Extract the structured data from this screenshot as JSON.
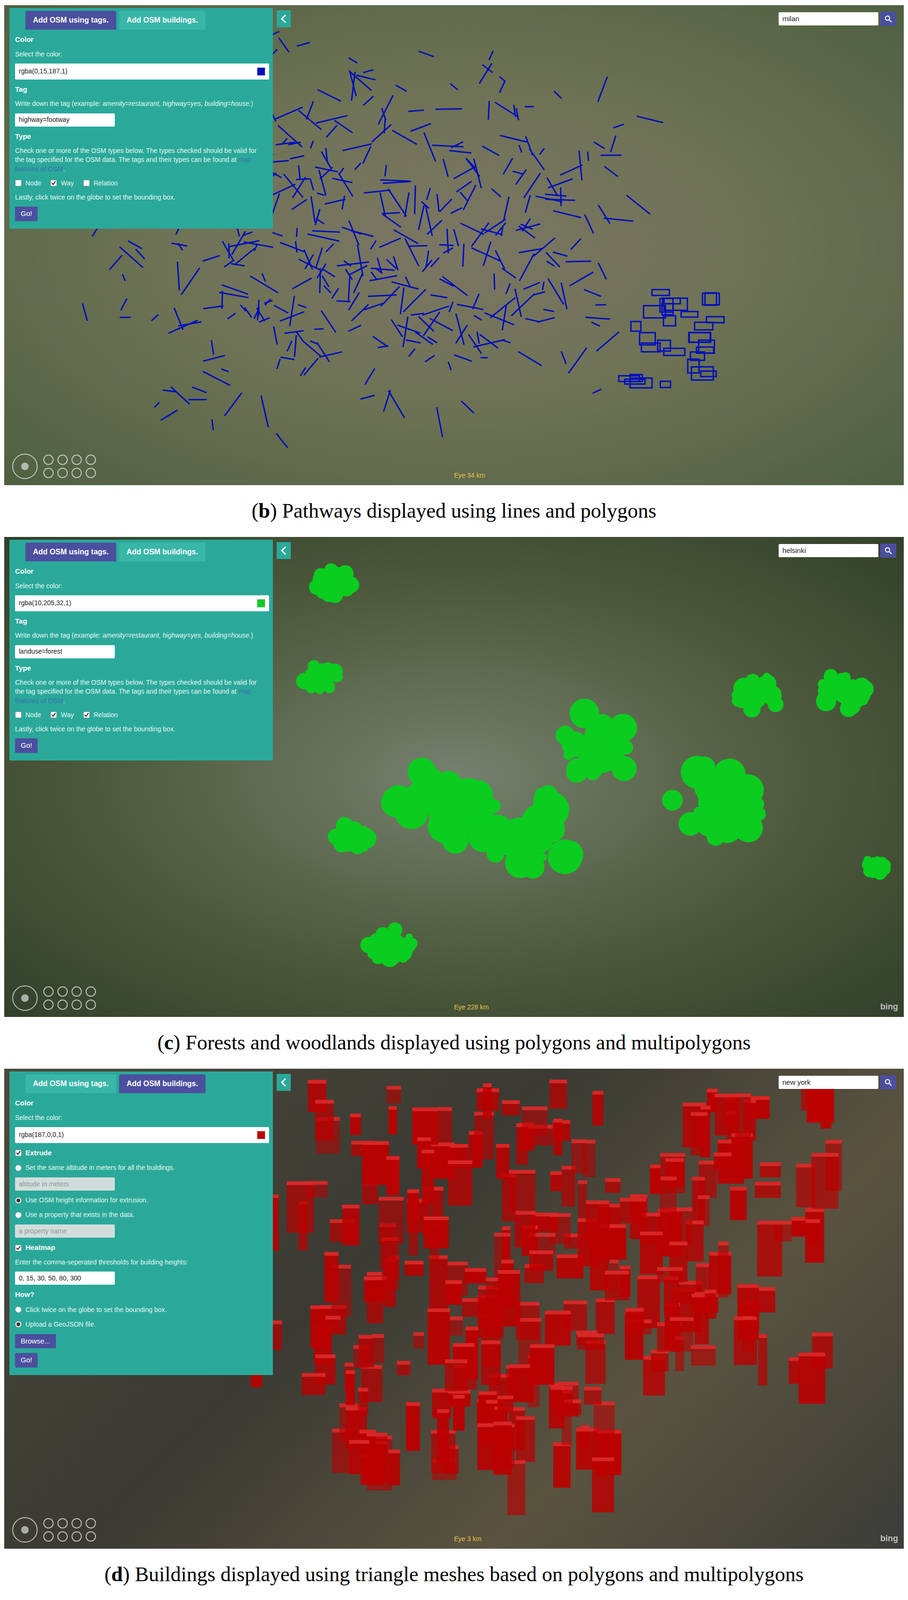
{
  "figures": [
    {
      "caption": {
        "open": "(",
        "letter": "b",
        "rest": ") Pathways displayed using lines and polygons"
      },
      "map": {
        "search": "milan",
        "eye": "Eye 34 km",
        "color": "#000fbb",
        "features": "lines"
      },
      "tabs": [
        {
          "label": "Add OSM using tags.",
          "selected": true
        },
        {
          "label": "Add OSM buildings.",
          "selected": false
        }
      ],
      "form": [
        {
          "kind": "heading",
          "text": "Color"
        },
        {
          "kind": "text",
          "text": "Select the color:"
        },
        {
          "kind": "color",
          "value": "rgba(0,15,187,1)",
          "swatch": "#000fbb"
        },
        {
          "kind": "heading",
          "text": "Tag"
        },
        {
          "kind": "tag-help",
          "before": "Write down the tag (example: ",
          "examples": "amenity=restaurant, highway=yes, building=house.",
          "after": ")"
        },
        {
          "kind": "input",
          "value": "highway=footway",
          "placeholder": "",
          "disabled": false
        },
        {
          "kind": "heading",
          "text": "Type"
        },
        {
          "kind": "link-help",
          "before": "Check one or more of the OSM types below. The types checked should be valid for the tag specified for the OSM data. The tags and their types can be found at ",
          "link": "map features of OSM",
          "after": "."
        },
        {
          "kind": "checks",
          "items": [
            {
              "label": "Node",
              "checked": false
            },
            {
              "label": "Way",
              "checked": true
            },
            {
              "label": "Relation",
              "checked": false
            }
          ]
        },
        {
          "kind": "text",
          "text": "Lastly, click twice on the globe to set the bounding box."
        },
        {
          "kind": "button",
          "text": "Go!"
        }
      ]
    },
    {
      "caption": {
        "open": "(",
        "letter": "c",
        "rest": ") Forests and woodlands displayed using polygons and multipolygons"
      },
      "map": {
        "search": "helsinki",
        "eye": "Eye 228 km",
        "attribution": "bing",
        "color": "#0acd20",
        "features": "blobs"
      },
      "tabs": [
        {
          "label": "Add OSM using tags.",
          "selected": true
        },
        {
          "label": "Add OSM buildings.",
          "selected": false
        }
      ],
      "form": [
        {
          "kind": "heading",
          "text": "Color"
        },
        {
          "kind": "text",
          "text": "Select the color:"
        },
        {
          "kind": "color",
          "value": "rgba(10,205,32,1)",
          "swatch": "#0acd20"
        },
        {
          "kind": "heading",
          "text": "Tag"
        },
        {
          "kind": "tag-help",
          "before": "Write down the tag (example: ",
          "examples": "amenity=restaurant, highway=yes, building=house.",
          "after": ")"
        },
        {
          "kind": "input",
          "value": "landuse=forest",
          "placeholder": "",
          "disabled": false
        },
        {
          "kind": "heading",
          "text": "Type"
        },
        {
          "kind": "link-help",
          "before": "Check one or more of the OSM types below. The types checked should be valid for the tag specified for the OSM data. The tags and their types can be found at ",
          "link": "map features of OSM",
          "after": "."
        },
        {
          "kind": "checks",
          "items": [
            {
              "label": "Node",
              "checked": false
            },
            {
              "label": "Way",
              "checked": true
            },
            {
              "label": "Relation",
              "checked": true
            }
          ]
        },
        {
          "kind": "text",
          "text": "Lastly, click twice on the globe to set the bounding box."
        },
        {
          "kind": "button",
          "text": "Go!"
        }
      ]
    },
    {
      "caption": {
        "open": "(",
        "letter": "d",
        "rest": ") Buildings displayed using triangle meshes based on polygons and multipolygons"
      },
      "map": {
        "search": "new york",
        "eye": "Eye 3 km",
        "attribution": "bing",
        "color": "#bb0000",
        "features": "buildings"
      },
      "tabs": [
        {
          "label": "Add OSM using tags.",
          "selected": false
        },
        {
          "label": "Add OSM buildings.",
          "selected": true
        }
      ],
      "form": [
        {
          "kind": "heading",
          "text": "Color"
        },
        {
          "kind": "text",
          "text": "Select the color:"
        },
        {
          "kind": "color",
          "value": "rgba(187,0,0,1)",
          "swatch": "#bb0000"
        },
        {
          "kind": "checkbox",
          "label": "Extrude",
          "checked": true
        },
        {
          "kind": "radio",
          "label": "Set the same altitude in meters for all the buildings.",
          "selected": false
        },
        {
          "kind": "input",
          "value": "",
          "placeholder": "altitude in meters",
          "disabled": true
        },
        {
          "kind": "radio",
          "label": "Use OSM height information for extrusion.",
          "selected": true
        },
        {
          "kind": "radio",
          "label": "Use a property that exists in the data.",
          "selected": false
        },
        {
          "kind": "input",
          "value": "",
          "placeholder": "a property name",
          "disabled": true
        },
        {
          "kind": "checkbox",
          "label": "Heatmap",
          "checked": true
        },
        {
          "kind": "text",
          "text": "Enter the comma-seperated thresholds for building heights:"
        },
        {
          "kind": "input",
          "value": "0, 15, 30, 50, 80, 300",
          "placeholder": "",
          "disabled": false
        },
        {
          "kind": "heading",
          "text": "How?"
        },
        {
          "kind": "radio",
          "label": "Click twice on the globe to set the bounding box.",
          "selected": false
        },
        {
          "kind": "radio",
          "label": "Upload a GeoJSON file.",
          "selected": true
        },
        {
          "kind": "button",
          "text": "Browse..."
        },
        {
          "kind": "button",
          "text": "Go!"
        }
      ]
    }
  ]
}
